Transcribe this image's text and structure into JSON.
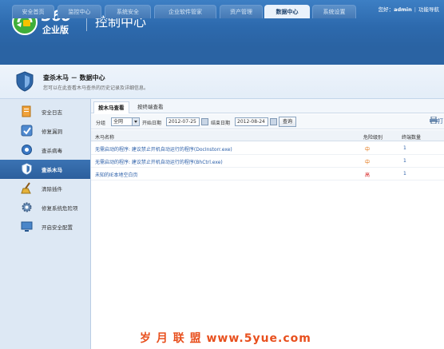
{
  "header": {
    "brand_num": "360",
    "brand_sub": "企业版",
    "app_title": "控制中心",
    "greeting": "您好：",
    "username": "admin",
    "menu_label": "功能导航"
  },
  "tabs": [
    {
      "label": "安全首页"
    },
    {
      "label": "监控中心"
    },
    {
      "label": "系统安全"
    },
    {
      "label": "企业软件管家"
    },
    {
      "label": "资产管理"
    },
    {
      "label": "数据中心"
    },
    {
      "label": "系统设置"
    }
  ],
  "page": {
    "title": "查杀木马 － 数据中心",
    "subtitle": "您可以在此查看木马查杀的历史记录及详细信息。"
  },
  "sidebar": {
    "items": [
      {
        "label": "安全日志"
      },
      {
        "label": "修复漏洞"
      },
      {
        "label": "查杀病毒"
      },
      {
        "label": "查杀木马"
      },
      {
        "label": "清除插件"
      },
      {
        "label": "修复系统危险项"
      },
      {
        "label": "开启安全配置"
      }
    ]
  },
  "subtabs": [
    {
      "label": "按木马查看"
    },
    {
      "label": "按终端查看"
    }
  ],
  "filter": {
    "group_label": "分组",
    "group_value": "全网",
    "start_label": "开始日期",
    "start_value": "2012-07-25",
    "end_label": "结束日期",
    "end_value": "2012-08-24",
    "query_label": "查询",
    "print_label": "打"
  },
  "table": {
    "headers": [
      "木马名称",
      "危险级别",
      "终端数量"
    ],
    "rows": [
      {
        "name": "无需启动的程序: 建议禁止开机自动运行的程序(DocInstorr.exe)",
        "level": "中",
        "count": "1"
      },
      {
        "name": "无需启动的程序: 建议禁止开机自动运行的程序(BhCtrl.exe)",
        "level": "中",
        "count": "1"
      },
      {
        "name": "未知的IE本地空白页",
        "level": "高",
        "count": "1"
      }
    ]
  },
  "watermark": "岁 月 联 盟   www.5yue.com",
  "colors": {
    "header_blue": "#2d6aae",
    "active_tab": "#eaf2fb",
    "sidebar_bg": "#dde8f4",
    "link_blue": "#2a5ea8",
    "level_mid": "#e06a00",
    "level_high": "#d62020"
  }
}
